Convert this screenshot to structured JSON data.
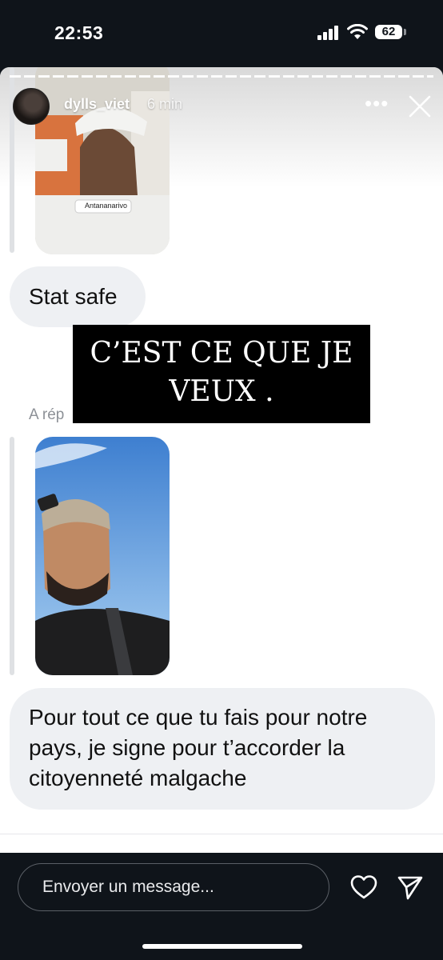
{
  "status_bar": {
    "time": "22:53",
    "battery": "62"
  },
  "story": {
    "username": "dylls_viet",
    "time_ago": "6 min",
    "more_icon": "more-horizontal-icon",
    "close_icon": "close-icon"
  },
  "messages": {
    "location_tag": "Antananarivo",
    "bubble1": "Stat safe",
    "reply_label": "A rép",
    "bubble2": "Pour tout ce que tu fais pour notre pays, je signe pour t’accorder la citoyenneté malgache"
  },
  "overlay": {
    "line1": "C’EST CE QUE JE",
    "line2": "VEUX ."
  },
  "composer": {
    "placeholder": "Envoyer un message..."
  },
  "colors": {
    "background": "#0f141a",
    "bubble": "#eef0f3",
    "overlay": "#000000"
  }
}
